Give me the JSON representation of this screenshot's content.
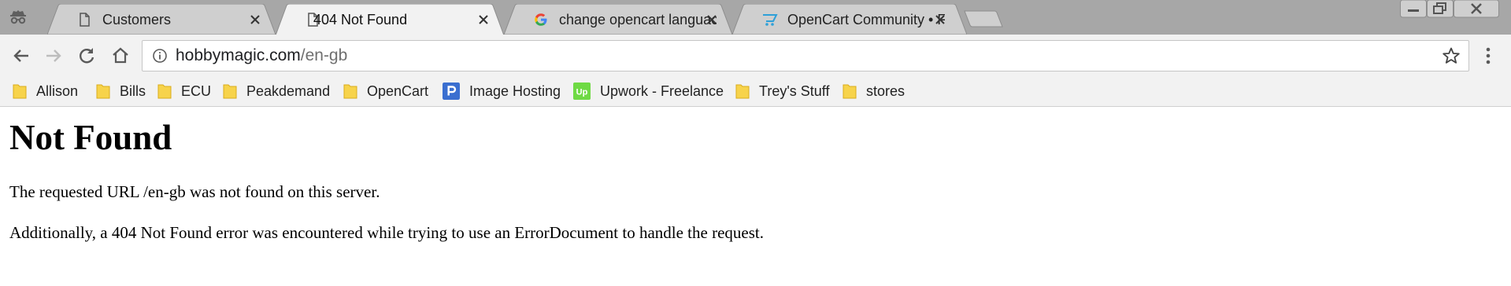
{
  "tabs": [
    {
      "title": "Customers",
      "icon": "page-icon"
    },
    {
      "title": "404 Not Found",
      "icon": "page-icon"
    },
    {
      "title": "change opencart languac",
      "icon": "google-icon"
    },
    {
      "title": "OpenCart Community • F",
      "icon": "opencart-cart-icon"
    }
  ],
  "active_tab": 1,
  "address": {
    "host": "hobbymagic.com",
    "path": "/en-gb"
  },
  "bookmarks": [
    {
      "label": "Allison",
      "icon": "folder-icon"
    },
    {
      "label": "Bills",
      "icon": "folder-icon"
    },
    {
      "label": "ECU",
      "icon": "folder-icon"
    },
    {
      "label": "Peakdemand",
      "icon": "folder-icon"
    },
    {
      "label": "OpenCart",
      "icon": "folder-icon"
    },
    {
      "label": "Image Hosting",
      "icon": "postimage-icon"
    },
    {
      "label": "Upwork - Freelance",
      "icon": "upwork-icon"
    },
    {
      "label": "Trey's Stuff",
      "icon": "folder-icon"
    },
    {
      "label": "stores",
      "icon": "folder-icon"
    }
  ],
  "upwork_icon_text": "Up",
  "page": {
    "heading": "Not Found",
    "message": "The requested URL /en-gb was not found on this server.",
    "additional": "Additionally, a 404 Not Found error was encountered while trying to use an ErrorDocument to handle the request."
  },
  "colors": {
    "tabstrip": "#a7a7a7",
    "inactive_tab": "#cfcfcf",
    "active_tab": "#f2f2f2",
    "folder": "#f7d34b",
    "upwork": "#6fda44",
    "postimage": "#3a6fd0"
  }
}
